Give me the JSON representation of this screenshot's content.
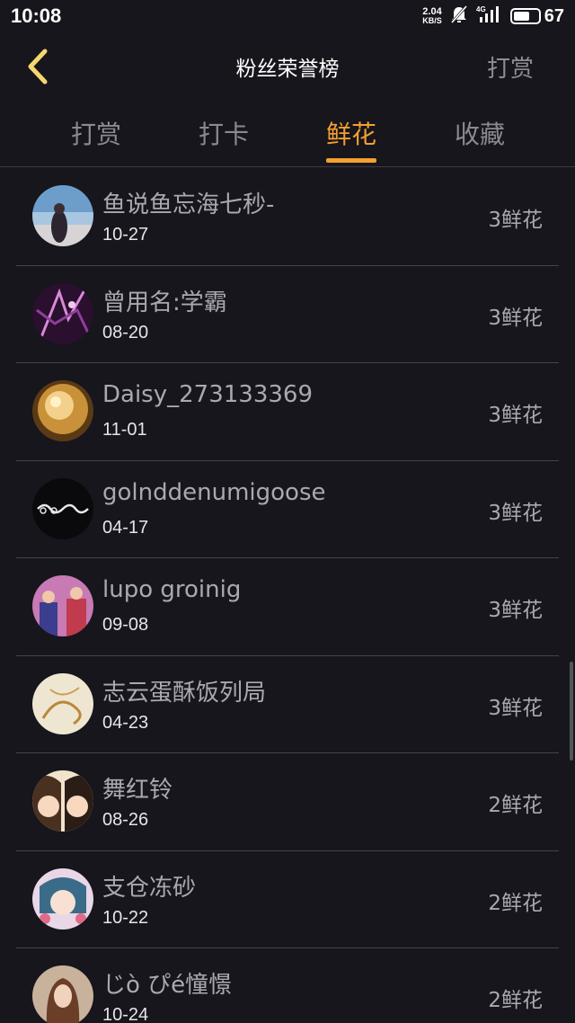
{
  "status_bar": {
    "time": "10:08",
    "net_speed_value": "2.04",
    "net_speed_unit": "KB/S",
    "network": "4G",
    "battery_level": "67"
  },
  "header": {
    "title": "粉丝荣誉榜",
    "action_label": "打赏",
    "back_icon": "chevron-left-icon"
  },
  "tabs": [
    {
      "label": "打赏",
      "active": false
    },
    {
      "label": "打卡",
      "active": false
    },
    {
      "label": "鲜花",
      "active": true
    },
    {
      "label": "收藏",
      "active": false
    }
  ],
  "colors": {
    "background": "#16161c",
    "accent": "#f5a030",
    "divider": "#44444b",
    "muted_text": "#a9a9af"
  },
  "fans": [
    {
      "name": "鱼说鱼忘海七秒-",
      "date": "10-27",
      "amount": "3鲜花",
      "avatar": "beach-girl"
    },
    {
      "name": "曾用名:学霸",
      "date": "08-20",
      "amount": "3鲜花",
      "avatar": "purple-sparkle"
    },
    {
      "name": "Daisy_273133369",
      "date": "11-01",
      "amount": "3鲜花",
      "avatar": "golden-glow"
    },
    {
      "name": "golnddenumigoose",
      "date": "04-17",
      "amount": "3鲜花",
      "avatar": "goodbye-text"
    },
    {
      "name": "lupo groinig",
      "date": "09-08",
      "amount": "3鲜花",
      "avatar": "pink-figures"
    },
    {
      "name": "志云蛋酥饭列局",
      "date": "04-23",
      "amount": "3鲜花",
      "avatar": "beige-sketch"
    },
    {
      "name": "舞红铃",
      "date": "08-26",
      "amount": "2鲜花",
      "avatar": "anime-pair"
    },
    {
      "name": "支仓冻砂",
      "date": "10-22",
      "amount": "2鲜花",
      "avatar": "anime-girl"
    },
    {
      "name": "じò ぴé憧憬",
      "date": "10-24",
      "amount": "2鲜花",
      "avatar": "long-hair"
    }
  ]
}
